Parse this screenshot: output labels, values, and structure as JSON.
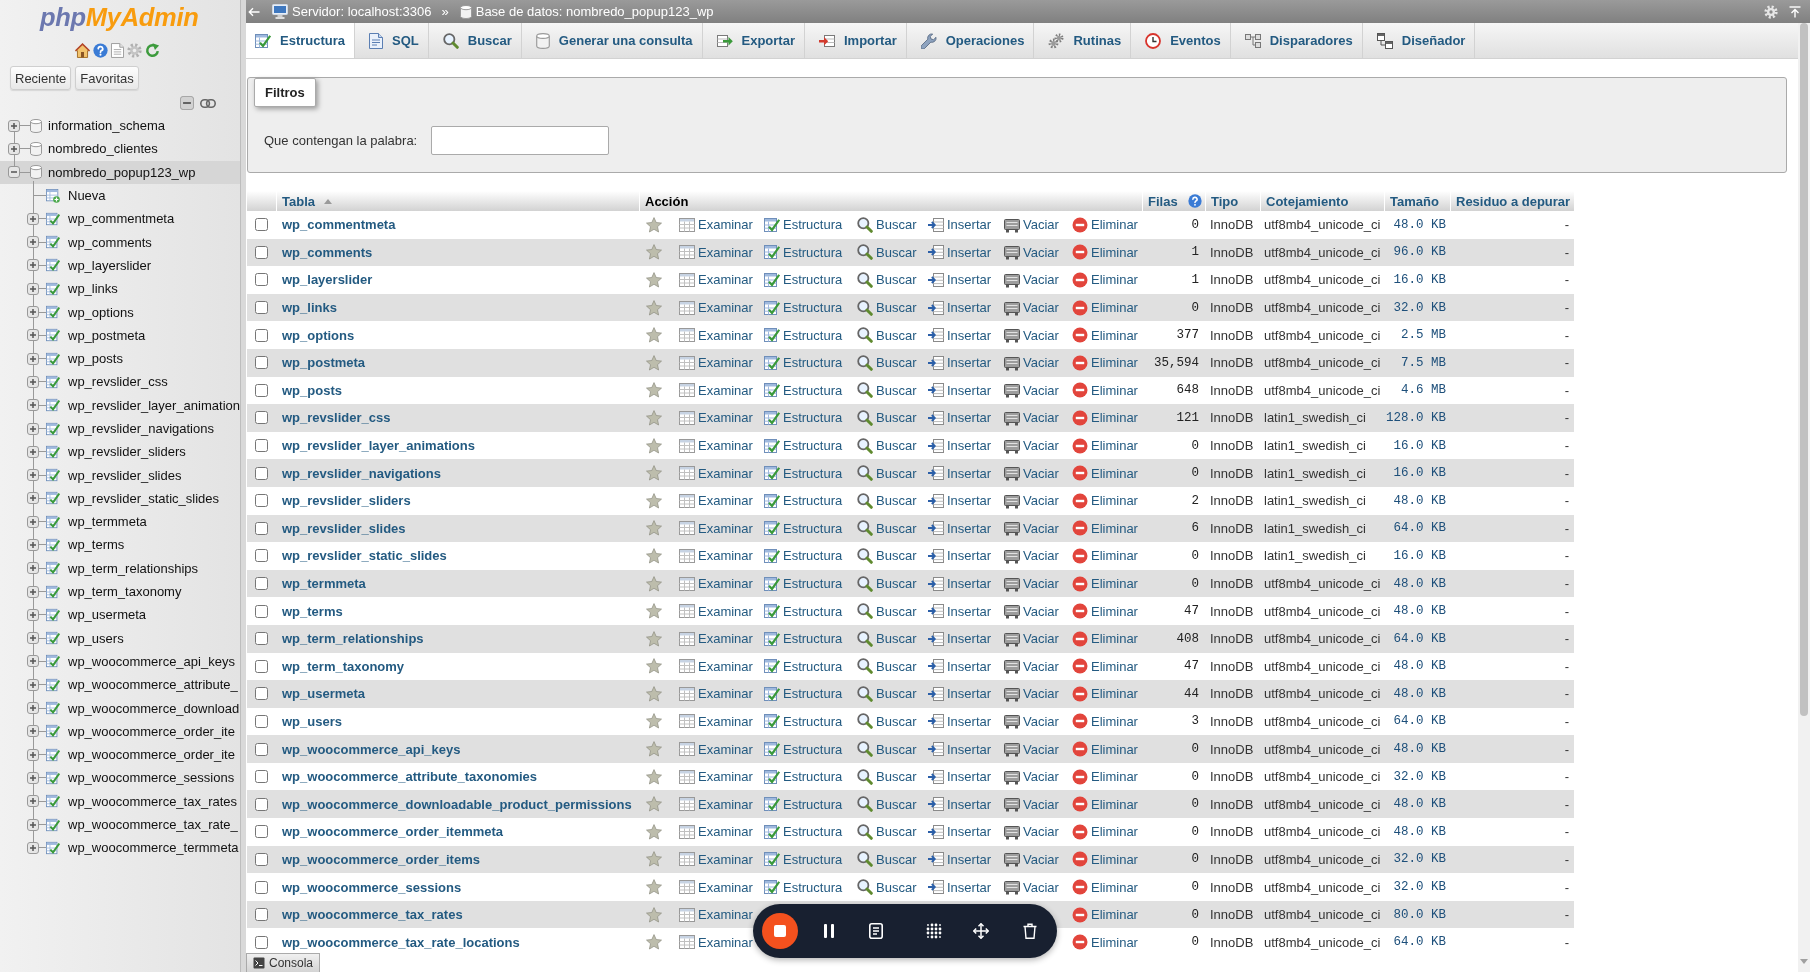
{
  "sidebar": {
    "logo": [
      {
        "text": "php",
        "color": "#6c78af"
      },
      {
        "text": "MyAdmin",
        "color": "#f89c0e"
      }
    ],
    "buttons": [
      {
        "label": "Reciente"
      },
      {
        "label": "Favoritas"
      }
    ],
    "tree": [
      {
        "name": "information_schema",
        "kind": "database",
        "expanded": false,
        "selected": false
      },
      {
        "name": "nombredo_clientes",
        "kind": "database",
        "expanded": false,
        "selected": false
      },
      {
        "name": "nombredo_popup123_wp",
        "kind": "database",
        "expanded": true,
        "selected": true,
        "children": [
          {
            "name": "Nueva",
            "kind": "new",
            "selected": false
          },
          {
            "name": "wp_commentmeta",
            "kind": "table",
            "expanded": false,
            "selected": false
          },
          {
            "name": "wp_comments",
            "kind": "table",
            "expanded": false,
            "selected": false
          },
          {
            "name": "wp_layerslider",
            "kind": "table",
            "expanded": false,
            "selected": false
          },
          {
            "name": "wp_links",
            "kind": "table",
            "expanded": false,
            "selected": false
          },
          {
            "name": "wp_options",
            "kind": "table",
            "expanded": false,
            "selected": false
          },
          {
            "name": "wp_postmeta",
            "kind": "table",
            "expanded": false,
            "selected": false
          },
          {
            "name": "wp_posts",
            "kind": "table",
            "expanded": false,
            "selected": false
          },
          {
            "name": "wp_revslider_css",
            "kind": "table",
            "expanded": false,
            "selected": false
          },
          {
            "name": "wp_revslider_layer_animation",
            "kind": "table",
            "expanded": false,
            "selected": false
          },
          {
            "name": "wp_revslider_navigations",
            "kind": "table",
            "expanded": false,
            "selected": false
          },
          {
            "name": "wp_revslider_sliders",
            "kind": "table",
            "expanded": false,
            "selected": false
          },
          {
            "name": "wp_revslider_slides",
            "kind": "table",
            "expanded": false,
            "selected": false
          },
          {
            "name": "wp_revslider_static_slides",
            "kind": "table",
            "expanded": false,
            "selected": false
          },
          {
            "name": "wp_termmeta",
            "kind": "table",
            "expanded": false,
            "selected": false
          },
          {
            "name": "wp_terms",
            "kind": "table",
            "expanded": false,
            "selected": false
          },
          {
            "name": "wp_term_relationships",
            "kind": "table",
            "expanded": false,
            "selected": false
          },
          {
            "name": "wp_term_taxonomy",
            "kind": "table",
            "expanded": false,
            "selected": false
          },
          {
            "name": "wp_usermeta",
            "kind": "table",
            "expanded": false,
            "selected": false
          },
          {
            "name": "wp_users",
            "kind": "table",
            "expanded": false,
            "selected": false
          },
          {
            "name": "wp_woocommerce_api_keys",
            "kind": "table",
            "expanded": false,
            "selected": false
          },
          {
            "name": "wp_woocommerce_attribute_",
            "kind": "table",
            "expanded": false,
            "selected": false
          },
          {
            "name": "wp_woocommerce_download",
            "kind": "table",
            "expanded": false,
            "selected": false
          },
          {
            "name": "wp_woocommerce_order_ite",
            "kind": "table",
            "expanded": false,
            "selected": false
          },
          {
            "name": "wp_woocommerce_order_ite",
            "kind": "table",
            "expanded": false,
            "selected": false
          },
          {
            "name": "wp_woocommerce_sessions",
            "kind": "table",
            "expanded": false,
            "selected": false
          },
          {
            "name": "wp_woocommerce_tax_rates",
            "kind": "table",
            "expanded": false,
            "selected": false
          },
          {
            "name": "wp_woocommerce_tax_rate_",
            "kind": "table",
            "expanded": false,
            "selected": false
          },
          {
            "name": "wp_woocommerce_termmeta",
            "kind": "table",
            "expanded": false,
            "selected": false
          }
        ]
      }
    ]
  },
  "breadcrumb": {
    "items": [
      {
        "kind": "server",
        "label": "Servidor: localhost:3306"
      },
      {
        "kind": "database",
        "label": "Base de datos: nombredo_popup123_wp"
      }
    ],
    "separator": "»"
  },
  "tabs": [
    {
      "kind": "structure",
      "label": "Estructura",
      "selected": true
    },
    {
      "kind": "sql",
      "label": "SQL",
      "selected": false
    },
    {
      "kind": "search",
      "label": "Buscar",
      "selected": false
    },
    {
      "kind": "query",
      "label": "Generar una consulta",
      "selected": false
    },
    {
      "kind": "export",
      "label": "Exportar",
      "selected": false
    },
    {
      "kind": "import",
      "label": "Importar",
      "selected": false
    },
    {
      "kind": "operations",
      "label": "Operaciones",
      "selected": false
    },
    {
      "kind": "routines",
      "label": "Rutinas",
      "selected": false
    },
    {
      "kind": "events",
      "label": "Eventos",
      "selected": false
    },
    {
      "kind": "triggers",
      "label": "Disparadores",
      "selected": false
    },
    {
      "kind": "designer",
      "label": "Diseñador",
      "selected": false
    }
  ],
  "filters": {
    "legend": "Filtros",
    "label": "Que contengan la palabra:"
  },
  "table": {
    "columns": [
      {
        "label": "Tabla",
        "sortable": true,
        "sorted": true
      },
      {
        "label": "Acción",
        "sortable": false
      },
      {
        "label": "Filas",
        "sortable": true,
        "help": true
      },
      {
        "label": "Tipo",
        "sortable": true
      },
      {
        "label": "Cotejamiento",
        "sortable": true
      },
      {
        "label": "Tamaño",
        "sortable": true
      },
      {
        "label": "Residuo a depurar",
        "sortable": true
      }
    ],
    "rows": [
      {
        "name": "wp_commentmeta",
        "checked": false,
        "favorite": false,
        "actions": [
          {
            "kind": "browse",
            "label": "Examinar"
          },
          {
            "kind": "structure",
            "label": "Estructura"
          },
          {
            "kind": "search",
            "label": "Buscar"
          },
          {
            "kind": "insert",
            "label": "Insertar"
          },
          {
            "kind": "empty",
            "label": "Vaciar"
          },
          {
            "kind": "drop",
            "label": "Eliminar"
          }
        ],
        "row_count": "0",
        "engine": "InnoDB",
        "collation": "utf8mb4_unicode_ci",
        "size": "48.0 KB",
        "overhead": "-"
      },
      {
        "name": "wp_comments",
        "checked": false,
        "favorite": false,
        "actions": [
          {
            "kind": "browse",
            "label": "Examinar"
          },
          {
            "kind": "structure",
            "label": "Estructura"
          },
          {
            "kind": "search",
            "label": "Buscar"
          },
          {
            "kind": "insert",
            "label": "Insertar"
          },
          {
            "kind": "empty",
            "label": "Vaciar"
          },
          {
            "kind": "drop",
            "label": "Eliminar"
          }
        ],
        "row_count": "1",
        "engine": "InnoDB",
        "collation": "utf8mb4_unicode_ci",
        "size": "96.0 KB",
        "overhead": "-"
      },
      {
        "name": "wp_layerslider",
        "checked": false,
        "favorite": false,
        "actions": [
          {
            "kind": "browse",
            "label": "Examinar"
          },
          {
            "kind": "structure",
            "label": "Estructura"
          },
          {
            "kind": "search",
            "label": "Buscar"
          },
          {
            "kind": "insert",
            "label": "Insertar"
          },
          {
            "kind": "empty",
            "label": "Vaciar"
          },
          {
            "kind": "drop",
            "label": "Eliminar"
          }
        ],
        "row_count": "1",
        "engine": "InnoDB",
        "collation": "utf8mb4_unicode_ci",
        "size": "16.0 KB",
        "overhead": "-"
      },
      {
        "name": "wp_links",
        "checked": false,
        "favorite": false,
        "actions": [
          {
            "kind": "browse",
            "label": "Examinar"
          },
          {
            "kind": "structure",
            "label": "Estructura"
          },
          {
            "kind": "search",
            "label": "Buscar"
          },
          {
            "kind": "insert",
            "label": "Insertar"
          },
          {
            "kind": "empty",
            "label": "Vaciar"
          },
          {
            "kind": "drop",
            "label": "Eliminar"
          }
        ],
        "row_count": "0",
        "engine": "InnoDB",
        "collation": "utf8mb4_unicode_ci",
        "size": "32.0 KB",
        "overhead": "-"
      },
      {
        "name": "wp_options",
        "checked": false,
        "favorite": false,
        "actions": [
          {
            "kind": "browse",
            "label": "Examinar"
          },
          {
            "kind": "structure",
            "label": "Estructura"
          },
          {
            "kind": "search",
            "label": "Buscar"
          },
          {
            "kind": "insert",
            "label": "Insertar"
          },
          {
            "kind": "empty",
            "label": "Vaciar"
          },
          {
            "kind": "drop",
            "label": "Eliminar"
          }
        ],
        "row_count": "377",
        "engine": "InnoDB",
        "collation": "utf8mb4_unicode_ci",
        "size": "2.5 MB",
        "overhead": "-"
      },
      {
        "name": "wp_postmeta",
        "checked": false,
        "favorite": false,
        "actions": [
          {
            "kind": "browse",
            "label": "Examinar"
          },
          {
            "kind": "structure",
            "label": "Estructura"
          },
          {
            "kind": "search",
            "label": "Buscar"
          },
          {
            "kind": "insert",
            "label": "Insertar"
          },
          {
            "kind": "empty",
            "label": "Vaciar"
          },
          {
            "kind": "drop",
            "label": "Eliminar"
          }
        ],
        "row_count": "35,594",
        "engine": "InnoDB",
        "collation": "utf8mb4_unicode_ci",
        "size": "7.5 MB",
        "overhead": "-"
      },
      {
        "name": "wp_posts",
        "checked": false,
        "favorite": false,
        "actions": [
          {
            "kind": "browse",
            "label": "Examinar"
          },
          {
            "kind": "structure",
            "label": "Estructura"
          },
          {
            "kind": "search",
            "label": "Buscar"
          },
          {
            "kind": "insert",
            "label": "Insertar"
          },
          {
            "kind": "empty",
            "label": "Vaciar"
          },
          {
            "kind": "drop",
            "label": "Eliminar"
          }
        ],
        "row_count": "648",
        "engine": "InnoDB",
        "collation": "utf8mb4_unicode_ci",
        "size": "4.6 MB",
        "overhead": "-"
      },
      {
        "name": "wp_revslider_css",
        "checked": false,
        "favorite": false,
        "actions": [
          {
            "kind": "browse",
            "label": "Examinar"
          },
          {
            "kind": "structure",
            "label": "Estructura"
          },
          {
            "kind": "search",
            "label": "Buscar"
          },
          {
            "kind": "insert",
            "label": "Insertar"
          },
          {
            "kind": "empty",
            "label": "Vaciar"
          },
          {
            "kind": "drop",
            "label": "Eliminar"
          }
        ],
        "row_count": "121",
        "engine": "InnoDB",
        "collation": "latin1_swedish_ci",
        "size": "128.0 KB",
        "overhead": "-"
      },
      {
        "name": "wp_revslider_layer_animations",
        "checked": false,
        "favorite": false,
        "actions": [
          {
            "kind": "browse",
            "label": "Examinar"
          },
          {
            "kind": "structure",
            "label": "Estructura"
          },
          {
            "kind": "search",
            "label": "Buscar"
          },
          {
            "kind": "insert",
            "label": "Insertar"
          },
          {
            "kind": "empty",
            "label": "Vaciar"
          },
          {
            "kind": "drop",
            "label": "Eliminar"
          }
        ],
        "row_count": "0",
        "engine": "InnoDB",
        "collation": "latin1_swedish_ci",
        "size": "16.0 KB",
        "overhead": "-"
      },
      {
        "name": "wp_revslider_navigations",
        "checked": false,
        "favorite": false,
        "actions": [
          {
            "kind": "browse",
            "label": "Examinar"
          },
          {
            "kind": "structure",
            "label": "Estructura"
          },
          {
            "kind": "search",
            "label": "Buscar"
          },
          {
            "kind": "insert",
            "label": "Insertar"
          },
          {
            "kind": "empty",
            "label": "Vaciar"
          },
          {
            "kind": "drop",
            "label": "Eliminar"
          }
        ],
        "row_count": "0",
        "engine": "InnoDB",
        "collation": "latin1_swedish_ci",
        "size": "16.0 KB",
        "overhead": "-"
      },
      {
        "name": "wp_revslider_sliders",
        "checked": false,
        "favorite": false,
        "actions": [
          {
            "kind": "browse",
            "label": "Examinar"
          },
          {
            "kind": "structure",
            "label": "Estructura"
          },
          {
            "kind": "search",
            "label": "Buscar"
          },
          {
            "kind": "insert",
            "label": "Insertar"
          },
          {
            "kind": "empty",
            "label": "Vaciar"
          },
          {
            "kind": "drop",
            "label": "Eliminar"
          }
        ],
        "row_count": "2",
        "engine": "InnoDB",
        "collation": "latin1_swedish_ci",
        "size": "48.0 KB",
        "overhead": "-"
      },
      {
        "name": "wp_revslider_slides",
        "checked": false,
        "favorite": false,
        "actions": [
          {
            "kind": "browse",
            "label": "Examinar"
          },
          {
            "kind": "structure",
            "label": "Estructura"
          },
          {
            "kind": "search",
            "label": "Buscar"
          },
          {
            "kind": "insert",
            "label": "Insertar"
          },
          {
            "kind": "empty",
            "label": "Vaciar"
          },
          {
            "kind": "drop",
            "label": "Eliminar"
          }
        ],
        "row_count": "6",
        "engine": "InnoDB",
        "collation": "latin1_swedish_ci",
        "size": "64.0 KB",
        "overhead": "-"
      },
      {
        "name": "wp_revslider_static_slides",
        "checked": false,
        "favorite": false,
        "actions": [
          {
            "kind": "browse",
            "label": "Examinar"
          },
          {
            "kind": "structure",
            "label": "Estructura"
          },
          {
            "kind": "search",
            "label": "Buscar"
          },
          {
            "kind": "insert",
            "label": "Insertar"
          },
          {
            "kind": "empty",
            "label": "Vaciar"
          },
          {
            "kind": "drop",
            "label": "Eliminar"
          }
        ],
        "row_count": "0",
        "engine": "InnoDB",
        "collation": "latin1_swedish_ci",
        "size": "16.0 KB",
        "overhead": "-"
      },
      {
        "name": "wp_termmeta",
        "checked": false,
        "favorite": false,
        "actions": [
          {
            "kind": "browse",
            "label": "Examinar"
          },
          {
            "kind": "structure",
            "label": "Estructura"
          },
          {
            "kind": "search",
            "label": "Buscar"
          },
          {
            "kind": "insert",
            "label": "Insertar"
          },
          {
            "kind": "empty",
            "label": "Vaciar"
          },
          {
            "kind": "drop",
            "label": "Eliminar"
          }
        ],
        "row_count": "0",
        "engine": "InnoDB",
        "collation": "utf8mb4_unicode_ci",
        "size": "48.0 KB",
        "overhead": "-"
      },
      {
        "name": "wp_terms",
        "checked": false,
        "favorite": false,
        "actions": [
          {
            "kind": "browse",
            "label": "Examinar"
          },
          {
            "kind": "structure",
            "label": "Estructura"
          },
          {
            "kind": "search",
            "label": "Buscar"
          },
          {
            "kind": "insert",
            "label": "Insertar"
          },
          {
            "kind": "empty",
            "label": "Vaciar"
          },
          {
            "kind": "drop",
            "label": "Eliminar"
          }
        ],
        "row_count": "47",
        "engine": "InnoDB",
        "collation": "utf8mb4_unicode_ci",
        "size": "48.0 KB",
        "overhead": "-"
      },
      {
        "name": "wp_term_relationships",
        "checked": false,
        "favorite": false,
        "actions": [
          {
            "kind": "browse",
            "label": "Examinar"
          },
          {
            "kind": "structure",
            "label": "Estructura"
          },
          {
            "kind": "search",
            "label": "Buscar"
          },
          {
            "kind": "insert",
            "label": "Insertar"
          },
          {
            "kind": "empty",
            "label": "Vaciar"
          },
          {
            "kind": "drop",
            "label": "Eliminar"
          }
        ],
        "row_count": "408",
        "engine": "InnoDB",
        "collation": "utf8mb4_unicode_ci",
        "size": "64.0 KB",
        "overhead": "-"
      },
      {
        "name": "wp_term_taxonomy",
        "checked": false,
        "favorite": false,
        "actions": [
          {
            "kind": "browse",
            "label": "Examinar"
          },
          {
            "kind": "structure",
            "label": "Estructura"
          },
          {
            "kind": "search",
            "label": "Buscar"
          },
          {
            "kind": "insert",
            "label": "Insertar"
          },
          {
            "kind": "empty",
            "label": "Vaciar"
          },
          {
            "kind": "drop",
            "label": "Eliminar"
          }
        ],
        "row_count": "47",
        "engine": "InnoDB",
        "collation": "utf8mb4_unicode_ci",
        "size": "48.0 KB",
        "overhead": "-"
      },
      {
        "name": "wp_usermeta",
        "checked": false,
        "favorite": false,
        "actions": [
          {
            "kind": "browse",
            "label": "Examinar"
          },
          {
            "kind": "structure",
            "label": "Estructura"
          },
          {
            "kind": "search",
            "label": "Buscar"
          },
          {
            "kind": "insert",
            "label": "Insertar"
          },
          {
            "kind": "empty",
            "label": "Vaciar"
          },
          {
            "kind": "drop",
            "label": "Eliminar"
          }
        ],
        "row_count": "44",
        "engine": "InnoDB",
        "collation": "utf8mb4_unicode_ci",
        "size": "48.0 KB",
        "overhead": "-"
      },
      {
        "name": "wp_users",
        "checked": false,
        "favorite": false,
        "actions": [
          {
            "kind": "browse",
            "label": "Examinar"
          },
          {
            "kind": "structure",
            "label": "Estructura"
          },
          {
            "kind": "search",
            "label": "Buscar"
          },
          {
            "kind": "insert",
            "label": "Insertar"
          },
          {
            "kind": "empty",
            "label": "Vaciar"
          },
          {
            "kind": "drop",
            "label": "Eliminar"
          }
        ],
        "row_count": "3",
        "engine": "InnoDB",
        "collation": "utf8mb4_unicode_ci",
        "size": "64.0 KB",
        "overhead": "-"
      },
      {
        "name": "wp_woocommerce_api_keys",
        "checked": false,
        "favorite": false,
        "actions": [
          {
            "kind": "browse",
            "label": "Examinar"
          },
          {
            "kind": "structure",
            "label": "Estructura"
          },
          {
            "kind": "search",
            "label": "Buscar"
          },
          {
            "kind": "insert",
            "label": "Insertar"
          },
          {
            "kind": "empty",
            "label": "Vaciar"
          },
          {
            "kind": "drop",
            "label": "Eliminar"
          }
        ],
        "row_count": "0",
        "engine": "InnoDB",
        "collation": "utf8mb4_unicode_ci",
        "size": "48.0 KB",
        "overhead": "-"
      },
      {
        "name": "wp_woocommerce_attribute_taxonomies",
        "checked": false,
        "favorite": false,
        "actions": [
          {
            "kind": "browse",
            "label": "Examinar"
          },
          {
            "kind": "structure",
            "label": "Estructura"
          },
          {
            "kind": "search",
            "label": "Buscar"
          },
          {
            "kind": "insert",
            "label": "Insertar"
          },
          {
            "kind": "empty",
            "label": "Vaciar"
          },
          {
            "kind": "drop",
            "label": "Eliminar"
          }
        ],
        "row_count": "0",
        "engine": "InnoDB",
        "collation": "utf8mb4_unicode_ci",
        "size": "32.0 KB",
        "overhead": "-"
      },
      {
        "name": "wp_woocommerce_downloadable_product_permissions",
        "checked": false,
        "favorite": false,
        "actions": [
          {
            "kind": "browse",
            "label": "Examinar"
          },
          {
            "kind": "structure",
            "label": "Estructura"
          },
          {
            "kind": "search",
            "label": "Buscar"
          },
          {
            "kind": "insert",
            "label": "Insertar"
          },
          {
            "kind": "empty",
            "label": "Vaciar"
          },
          {
            "kind": "drop",
            "label": "Eliminar"
          }
        ],
        "row_count": "0",
        "engine": "InnoDB",
        "collation": "utf8mb4_unicode_ci",
        "size": "48.0 KB",
        "overhead": "-"
      },
      {
        "name": "wp_woocommerce_order_itemmeta",
        "checked": false,
        "favorite": false,
        "actions": [
          {
            "kind": "browse",
            "label": "Examinar"
          },
          {
            "kind": "structure",
            "label": "Estructura"
          },
          {
            "kind": "search",
            "label": "Buscar"
          },
          {
            "kind": "insert",
            "label": "Insertar"
          },
          {
            "kind": "empty",
            "label": "Vaciar"
          },
          {
            "kind": "drop",
            "label": "Eliminar"
          }
        ],
        "row_count": "0",
        "engine": "InnoDB",
        "collation": "utf8mb4_unicode_ci",
        "size": "48.0 KB",
        "overhead": "-"
      },
      {
        "name": "wp_woocommerce_order_items",
        "checked": false,
        "favorite": false,
        "actions": [
          {
            "kind": "browse",
            "label": "Examinar"
          },
          {
            "kind": "structure",
            "label": "Estructura"
          },
          {
            "kind": "search",
            "label": "Buscar"
          },
          {
            "kind": "insert",
            "label": "Insertar"
          },
          {
            "kind": "empty",
            "label": "Vaciar"
          },
          {
            "kind": "drop",
            "label": "Eliminar"
          }
        ],
        "row_count": "0",
        "engine": "InnoDB",
        "collation": "utf8mb4_unicode_ci",
        "size": "32.0 KB",
        "overhead": "-"
      },
      {
        "name": "wp_woocommerce_sessions",
        "checked": false,
        "favorite": false,
        "actions": [
          {
            "kind": "browse",
            "label": "Examinar"
          },
          {
            "kind": "structure",
            "label": "Estructura"
          },
          {
            "kind": "search",
            "label": "Buscar"
          },
          {
            "kind": "insert",
            "label": "Insertar"
          },
          {
            "kind": "empty",
            "label": "Vaciar"
          },
          {
            "kind": "drop",
            "label": "Eliminar"
          }
        ],
        "row_count": "0",
        "engine": "InnoDB",
        "collation": "utf8mb4_unicode_ci",
        "size": "32.0 KB",
        "overhead": "-"
      },
      {
        "name": "wp_woocommerce_tax_rates",
        "checked": false,
        "favorite": false,
        "actions": [
          {
            "kind": "browse",
            "label": "Examinar"
          },
          {
            "kind": "drop",
            "label": "Eliminar"
          }
        ],
        "row_count": "0",
        "engine": "InnoDB",
        "collation": "utf8mb4_unicode_ci",
        "size": "80.0 KB",
        "overhead": "-"
      },
      {
        "name": "wp_woocommerce_tax_rate_locations",
        "checked": false,
        "favorite": false,
        "actions": [
          {
            "kind": "browse",
            "label": "Examinar"
          },
          {
            "kind": "drop",
            "label": "Eliminar"
          }
        ],
        "row_count": "0",
        "engine": "InnoDB",
        "collation": "utf8mb4_unicode_ci",
        "size": "64.0 KB",
        "overhead": "-"
      }
    ]
  },
  "console": {
    "label": "Consola"
  }
}
